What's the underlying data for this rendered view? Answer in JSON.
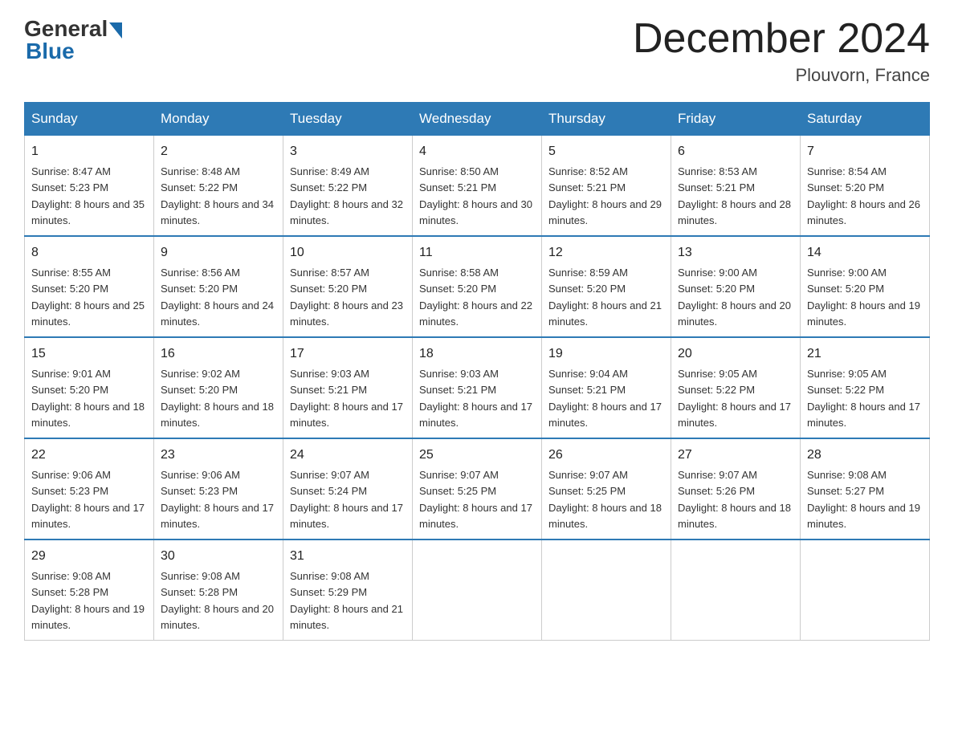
{
  "header": {
    "logo_general": "General",
    "logo_blue": "Blue",
    "title": "December 2024",
    "location": "Plouvorn, France"
  },
  "days_of_week": [
    "Sunday",
    "Monday",
    "Tuesday",
    "Wednesday",
    "Thursday",
    "Friday",
    "Saturday"
  ],
  "weeks": [
    [
      {
        "day": "1",
        "sunrise": "8:47 AM",
        "sunset": "5:23 PM",
        "daylight": "8 hours and 35 minutes."
      },
      {
        "day": "2",
        "sunrise": "8:48 AM",
        "sunset": "5:22 PM",
        "daylight": "8 hours and 34 minutes."
      },
      {
        "day": "3",
        "sunrise": "8:49 AM",
        "sunset": "5:22 PM",
        "daylight": "8 hours and 32 minutes."
      },
      {
        "day": "4",
        "sunrise": "8:50 AM",
        "sunset": "5:21 PM",
        "daylight": "8 hours and 30 minutes."
      },
      {
        "day": "5",
        "sunrise": "8:52 AM",
        "sunset": "5:21 PM",
        "daylight": "8 hours and 29 minutes."
      },
      {
        "day": "6",
        "sunrise": "8:53 AM",
        "sunset": "5:21 PM",
        "daylight": "8 hours and 28 minutes."
      },
      {
        "day": "7",
        "sunrise": "8:54 AM",
        "sunset": "5:20 PM",
        "daylight": "8 hours and 26 minutes."
      }
    ],
    [
      {
        "day": "8",
        "sunrise": "8:55 AM",
        "sunset": "5:20 PM",
        "daylight": "8 hours and 25 minutes."
      },
      {
        "day": "9",
        "sunrise": "8:56 AM",
        "sunset": "5:20 PM",
        "daylight": "8 hours and 24 minutes."
      },
      {
        "day": "10",
        "sunrise": "8:57 AM",
        "sunset": "5:20 PM",
        "daylight": "8 hours and 23 minutes."
      },
      {
        "day": "11",
        "sunrise": "8:58 AM",
        "sunset": "5:20 PM",
        "daylight": "8 hours and 22 minutes."
      },
      {
        "day": "12",
        "sunrise": "8:59 AM",
        "sunset": "5:20 PM",
        "daylight": "8 hours and 21 minutes."
      },
      {
        "day": "13",
        "sunrise": "9:00 AM",
        "sunset": "5:20 PM",
        "daylight": "8 hours and 20 minutes."
      },
      {
        "day": "14",
        "sunrise": "9:00 AM",
        "sunset": "5:20 PM",
        "daylight": "8 hours and 19 minutes."
      }
    ],
    [
      {
        "day": "15",
        "sunrise": "9:01 AM",
        "sunset": "5:20 PM",
        "daylight": "8 hours and 18 minutes."
      },
      {
        "day": "16",
        "sunrise": "9:02 AM",
        "sunset": "5:20 PM",
        "daylight": "8 hours and 18 minutes."
      },
      {
        "day": "17",
        "sunrise": "9:03 AM",
        "sunset": "5:21 PM",
        "daylight": "8 hours and 17 minutes."
      },
      {
        "day": "18",
        "sunrise": "9:03 AM",
        "sunset": "5:21 PM",
        "daylight": "8 hours and 17 minutes."
      },
      {
        "day": "19",
        "sunrise": "9:04 AM",
        "sunset": "5:21 PM",
        "daylight": "8 hours and 17 minutes."
      },
      {
        "day": "20",
        "sunrise": "9:05 AM",
        "sunset": "5:22 PM",
        "daylight": "8 hours and 17 minutes."
      },
      {
        "day": "21",
        "sunrise": "9:05 AM",
        "sunset": "5:22 PM",
        "daylight": "8 hours and 17 minutes."
      }
    ],
    [
      {
        "day": "22",
        "sunrise": "9:06 AM",
        "sunset": "5:23 PM",
        "daylight": "8 hours and 17 minutes."
      },
      {
        "day": "23",
        "sunrise": "9:06 AM",
        "sunset": "5:23 PM",
        "daylight": "8 hours and 17 minutes."
      },
      {
        "day": "24",
        "sunrise": "9:07 AM",
        "sunset": "5:24 PM",
        "daylight": "8 hours and 17 minutes."
      },
      {
        "day": "25",
        "sunrise": "9:07 AM",
        "sunset": "5:25 PM",
        "daylight": "8 hours and 17 minutes."
      },
      {
        "day": "26",
        "sunrise": "9:07 AM",
        "sunset": "5:25 PM",
        "daylight": "8 hours and 18 minutes."
      },
      {
        "day": "27",
        "sunrise": "9:07 AM",
        "sunset": "5:26 PM",
        "daylight": "8 hours and 18 minutes."
      },
      {
        "day": "28",
        "sunrise": "9:08 AM",
        "sunset": "5:27 PM",
        "daylight": "8 hours and 19 minutes."
      }
    ],
    [
      {
        "day": "29",
        "sunrise": "9:08 AM",
        "sunset": "5:28 PM",
        "daylight": "8 hours and 19 minutes."
      },
      {
        "day": "30",
        "sunrise": "9:08 AM",
        "sunset": "5:28 PM",
        "daylight": "8 hours and 20 minutes."
      },
      {
        "day": "31",
        "sunrise": "9:08 AM",
        "sunset": "5:29 PM",
        "daylight": "8 hours and 21 minutes."
      },
      null,
      null,
      null,
      null
    ]
  ]
}
